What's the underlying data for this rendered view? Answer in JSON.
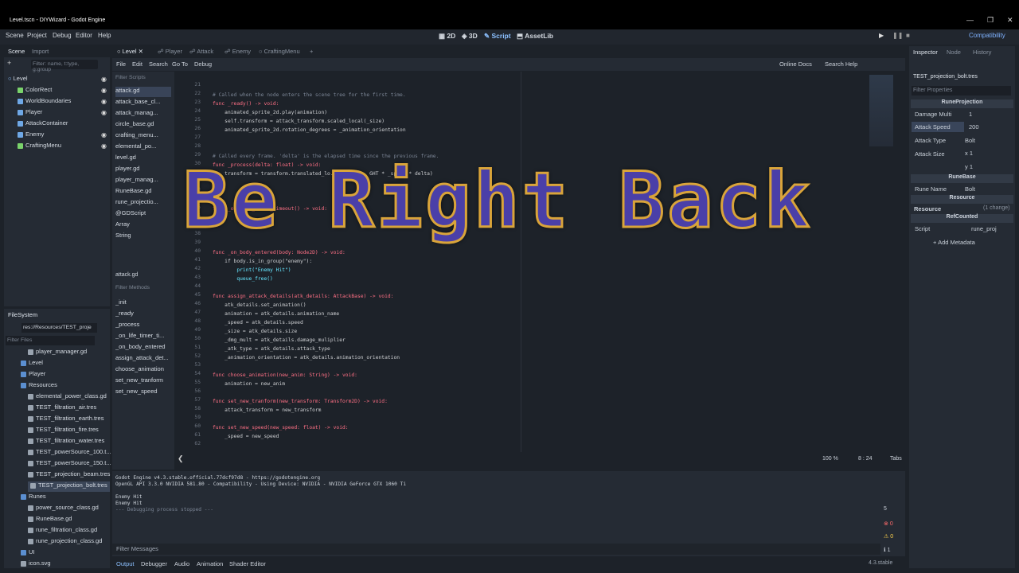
{
  "window": {
    "title": "Level.tscn - DIYWizard - Godot Engine",
    "controls": [
      "—",
      "❐",
      "✕"
    ]
  },
  "menubar": {
    "items": [
      "Scene",
      "Project",
      "Debug",
      "Editor",
      "Help"
    ],
    "main_buttons": [
      "2D",
      "3D",
      "Script",
      "AssetLib"
    ],
    "renderer": "Compatibility"
  },
  "scene_dock": {
    "tabs": [
      "Scene",
      "Import"
    ],
    "filter_placeholder": "Filter: name, t:type, g:group",
    "nodes": [
      "Level",
      "ColorRect",
      "WorldBoundaries",
      "Player",
      "AttackContainer",
      "Enemy",
      "CraftingMenu"
    ]
  },
  "filesystem": {
    "tab": "FileSystem",
    "path": "res://Resources/TEST_proje",
    "filter_placeholder": "Filter Files",
    "items": [
      "player_manager.gd",
      "Level",
      "Player",
      "Resources",
      "elemental_power_class.gd",
      "TEST_filtration_air.tres",
      "TEST_filtration_earth.tres",
      "TEST_filtration_fire.tres",
      "TEST_filtration_water.tres",
      "TEST_powerSource_100.t...",
      "TEST_powerSource_150.t...",
      "TEST_projection_beam.tres",
      "TEST_projection_bolt.tres",
      "Runes",
      "power_source_class.gd",
      "RuneBase.gd",
      "rune_filtration_class.gd",
      "rune_projection_class.gd",
      "UI",
      "icon.svg"
    ]
  },
  "editor_tabs": [
    "Level",
    "Player",
    "Attack",
    "Enemy",
    "CraftingMenu"
  ],
  "script_menu": {
    "items": [
      "File",
      "Edit",
      "Search",
      "Go To",
      "Debug"
    ],
    "online_docs": "Online Docs",
    "search_help": "Search Help"
  },
  "scripts": {
    "filter_placeholder": "Filter Scripts",
    "items": [
      "attack.gd",
      "attack_base_cl...",
      "attack_manag...",
      "circle_base.gd",
      "crafting_menu...",
      "elemental_po...",
      "level.gd",
      "player.gd",
      "player_manag...",
      "RuneBase.gd",
      "rune_projectio...",
      "@GDScript",
      "Array",
      "String"
    ],
    "current": "attack.gd",
    "methods_placeholder": "Filter Methods",
    "methods": [
      "_init",
      "_ready",
      "_process",
      "_on_life_timer_ti...",
      "_on_body_entered",
      "assign_attack_det...",
      "choose_animation",
      "set_new_tranform",
      "set_new_speed"
    ]
  },
  "code_lines": [
    {
      "n": "21",
      "t": ""
    },
    {
      "n": "22",
      "t": "# Called when the node enters the scene tree for the first time.",
      "c": "cm"
    },
    {
      "n": "23",
      "t": "func _ready() -> void:",
      "c": "kw"
    },
    {
      "n": "24",
      "t": "    animated_sprite_2d.play(animation)",
      "c": "id"
    },
    {
      "n": "25",
      "t": "    self.transform = attack_transform.scaled_local(_size)",
      "c": "id"
    },
    {
      "n": "26",
      "t": "    animated_sprite_2d.rotation_degrees = _animation_orientation",
      "c": "id"
    },
    {
      "n": "27",
      "t": ""
    },
    {
      "n": "28",
      "t": ""
    },
    {
      "n": "29",
      "t": "# Called every frame. 'delta' is the elapsed time since the previous frame.",
      "c": "cm"
    },
    {
      "n": "30",
      "t": "func _process(delta: float) -> void:",
      "c": "kw"
    },
    {
      "n": "31",
      "t": "    transform = transform.translated_lo...          GHT * _speed * delta)",
      "c": "id"
    },
    {
      "n": "32",
      "t": ""
    },
    {
      "n": "33",
      "t": ""
    },
    {
      "n": "34",
      "t": ""
    },
    {
      "n": "35",
      "t": "func _on_life_timer_timeout() -> void:",
      "c": "kw"
    },
    {
      "n": "36",
      "t": ""
    },
    {
      "n": "37",
      "t": ""
    },
    {
      "n": "38",
      "t": ""
    },
    {
      "n": "39",
      "t": ""
    },
    {
      "n": "40",
      "t": "func _on_body_entered(body: Node2D) -> void:",
      "c": "kw"
    },
    {
      "n": "41",
      "t": "    if body.is_in_group(\"enemy\"):",
      "c": "id"
    },
    {
      "n": "42",
      "t": "        print(\"Enemy Hit\")",
      "c": "fn"
    },
    {
      "n": "43",
      "t": "        queue_free()",
      "c": "fn"
    },
    {
      "n": "44",
      "t": ""
    },
    {
      "n": "45",
      "t": "func assign_attack_details(atk_details: AttackBase) -> void:",
      "c": "kw"
    },
    {
      "n": "46",
      "t": "    atk_details.set_animation()",
      "c": "id"
    },
    {
      "n": "47",
      "t": "    animation = atk_details.animation_name",
      "c": "id"
    },
    {
      "n": "48",
      "t": "    _speed = atk_details.speed",
      "c": "id"
    },
    {
      "n": "49",
      "t": "    _size = atk_details.size",
      "c": "id"
    },
    {
      "n": "50",
      "t": "    _dmg_mult = atk_details.damage_muliplier",
      "c": "id"
    },
    {
      "n": "51",
      "t": "    _atk_type = atk_details.attack_type",
      "c": "id"
    },
    {
      "n": "52",
      "t": "    _animation_orientation = atk_details.animation_orientation",
      "c": "id"
    },
    {
      "n": "53",
      "t": ""
    },
    {
      "n": "54",
      "t": "func choose_animation(new_anim: String) -> void:",
      "c": "kw"
    },
    {
      "n": "55",
      "t": "    animation = new_anim",
      "c": "id"
    },
    {
      "n": "56",
      "t": ""
    },
    {
      "n": "57",
      "t": "func set_new_tranform(new_transform: Transform2D) -> void:",
      "c": "kw"
    },
    {
      "n": "58",
      "t": "    attack_transform = new_transform",
      "c": "id"
    },
    {
      "n": "59",
      "t": ""
    },
    {
      "n": "60",
      "t": "func set_new_speed(new_speed: float) -> void:",
      "c": "kw"
    },
    {
      "n": "61",
      "t": "    _speed = new_speed",
      "c": "id"
    },
    {
      "n": "62",
      "t": ""
    }
  ],
  "status": {
    "zoom": "100 %",
    "position": "8 :  24",
    "indent": "Tabs"
  },
  "output": {
    "lines": [
      "Godot Engine v4.3.stable.official.77dcf97d8 - https://godotengine.org",
      "OpenGL API 3.3.0 NVIDIA 581.80 - Compatibility - Using Device: NVIDIA - NVIDIA GeForce GTX 1060 Ti",
      "",
      "Enemy Hit",
      "Enemy Hit",
      "--- Debugging process stopped ---"
    ],
    "filter_placeholder": "Filter Messages",
    "counts": [
      "5",
      "0",
      "0",
      "1"
    ]
  },
  "bottom_tabs": [
    "Output",
    "Debugger",
    "Audio",
    "Animation",
    "Shader Editor"
  ],
  "version": "4.3.stable",
  "inspector": {
    "tabs": [
      "Inspector",
      "Node",
      "History"
    ],
    "resource": "TEST_projection_bolt.tres",
    "filter_placeholder": "Filter Properties",
    "section": "RuneProjection",
    "props": [
      {
        "label": "Damage Multi",
        "value": "1"
      },
      {
        "label": "Attack Speed",
        "value": "200"
      },
      {
        "label": "Attack Type",
        "value": "Bolt"
      },
      {
        "label": "Attack Size",
        "value": "x 1"
      }
    ],
    "size_y": "y 1",
    "runebase": "RuneBase",
    "rune_name_label": "Rune Name",
    "rune_name": "Bolt",
    "resource_section": "Resource",
    "resource_sub": "Resource",
    "changes": "(1 change)",
    "refcounted": "RefCounted",
    "script_label": "Script",
    "script_value": "rune_proj",
    "add_metadata": "Add Metadata"
  },
  "overlay": {
    "text": "Be Right Back"
  }
}
